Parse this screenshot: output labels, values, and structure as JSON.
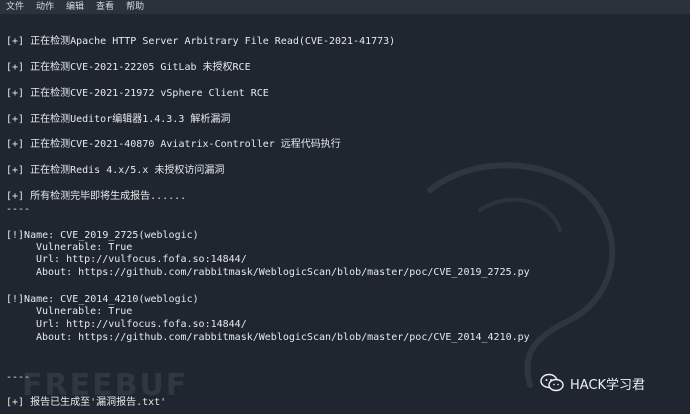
{
  "menubar": {
    "items": [
      "文件",
      "动作",
      "编辑",
      "查看",
      "帮助"
    ]
  },
  "terminal": {
    "lines": [
      "[+] 正在检测Apache HTTP Server Arbitrary File Read(CVE-2021-41773)",
      "[+] 正在检测CVE-2021-22205 GitLab 未授权RCE",
      "[+] 正在检测CVE-2021-21972 vSphere Client RCE",
      "[+] 正在检测Ueditor编辑器1.4.3.3 解析漏洞",
      "[+] 正在检测CVE-2021-40870 Aviatrix-Controller 远程代码执行",
      "[+] 正在检测Redis 4.x/5.x 未授权访问漏洞",
      "[+] 所有检测完毕即将生成报告......",
      "----",
      "[!]Name: CVE_2019_2725(weblogic)",
      "Vulnerable: True",
      "Url: http://vulfocus.fofa.so:14844/",
      "About: https://github.com/rabbitmask/WeblogicScan/blob/master/poc/CVE_2019_2725.py",
      "[!]Name: CVE_2014_4210(weblogic)",
      "Vulnerable: True",
      "Url: http://vulfocus.fofa.so:14844/",
      "About: https://github.com/rabbitmask/WeblogicScan/blob/master/poc/CVE_2014_4210.py",
      "----",
      "[+] 报告已生成至'漏洞报告.txt'"
    ]
  },
  "watermark": "FREEBUF",
  "brand": {
    "icon": "wechat-icon",
    "text": "HACK学习君"
  },
  "colors": {
    "background": "#1f2630",
    "menubar": "#2b323b",
    "text": "#e6e9ec"
  }
}
